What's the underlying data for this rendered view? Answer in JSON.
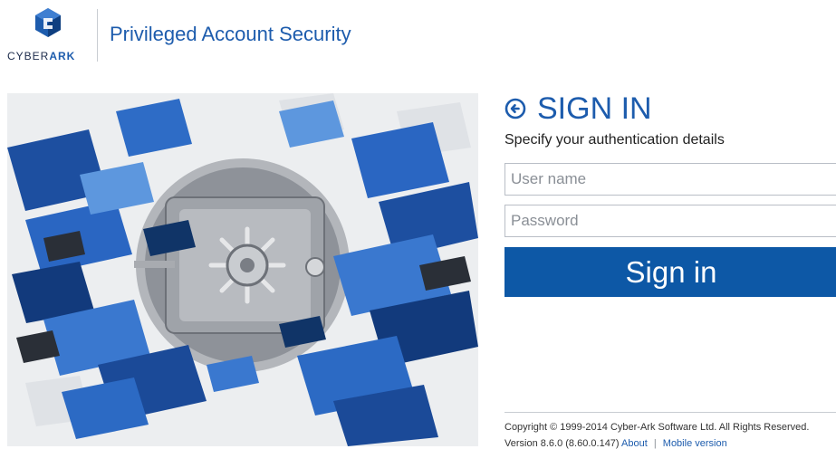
{
  "header": {
    "logo_text_prefix": "CYBER",
    "logo_text_suffix": "ARK",
    "app_title": "Privileged Account Security"
  },
  "signin": {
    "title": "SIGN IN",
    "subtitle": "Specify your authentication details",
    "username_placeholder": "User name",
    "password_placeholder": "Password",
    "button_label": "Sign in"
  },
  "footer": {
    "copyright": "Copyright © 1999-2014 Cyber-Ark Software Ltd. All Rights Reserved.",
    "version": "Version 8.6.0 (8.60.0.147)",
    "about_link": "About",
    "separator": "|",
    "mobile_link": "Mobile version"
  },
  "colors": {
    "brand_blue": "#1d5cad",
    "button_blue": "#0d58a6"
  }
}
